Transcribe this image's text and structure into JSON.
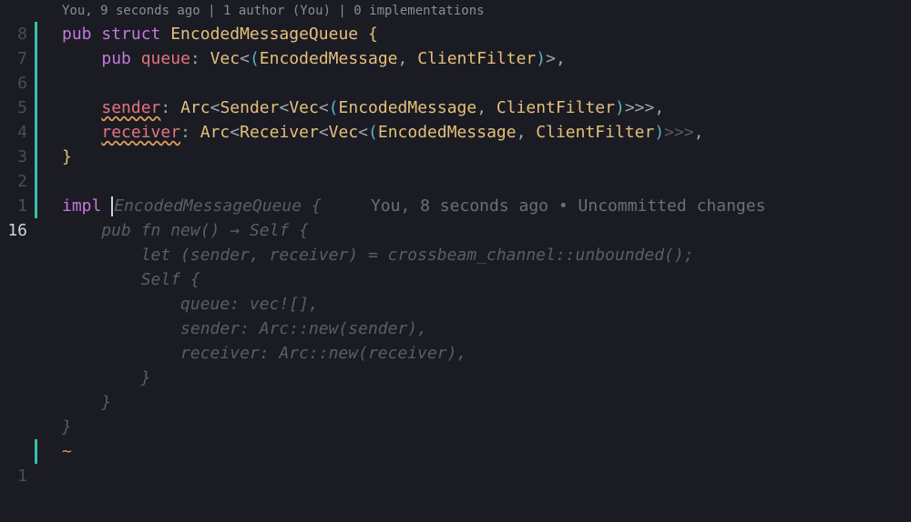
{
  "codelens": "You, 9 seconds ago | 1 author (You) | 0 implementations",
  "gutter": [
    "8",
    "7",
    "6",
    "5",
    "4",
    "3",
    "2",
    "1",
    "16",
    "",
    "",
    "",
    "",
    "",
    "",
    "",
    "",
    "",
    "1"
  ],
  "active_line_index": 8,
  "code": {
    "l1": {
      "pub": "pub ",
      "struct_kw": "struct ",
      "name": "EncodedMessageQueue",
      "brace": " {"
    },
    "l2": {
      "pad": "    ",
      "pub": "pub ",
      "field": "queue",
      "colon": ": ",
      "ty_vec": "Vec",
      "lt1": "<",
      "lp": "(",
      "t1": "EncodedMessage",
      "c1": ", ",
      "t2": "ClientFilter",
      "rp": ")",
      "gt1": ">",
      "c2": ","
    },
    "l4": {
      "pad": "    ",
      "field": "sender",
      "colon": ": ",
      "arc": "Arc",
      "lt1": "<",
      "sender": "Sender",
      "lt2": "<",
      "vec": "Vec",
      "lt3": "<",
      "lp": "(",
      "t1": "EncodedMessage",
      "c1": ", ",
      "t2": "ClientFilter",
      "rp": ")",
      "gt": ">>>",
      "c2": ","
    },
    "l5": {
      "pad": "    ",
      "field": "receiver",
      "colon": ": ",
      "arc": "Arc",
      "lt1": "<",
      "recv": "Receiver",
      "lt2": "<",
      "vec": "Vec",
      "lt3": "<",
      "lp": "(",
      "t1": "EncodedMessage",
      "c1": ", ",
      "t2": "ClientFilter",
      "rp": ")",
      "gt_dim": ">>>",
      "c2": ","
    },
    "l6": {
      "brace": "}"
    },
    "l8": {
      "impl": "impl ",
      "ghost_name": "EncodedMessageQueue {",
      "hint": "     You, 8 seconds ago • Uncommitted changes"
    },
    "g1": "    pub fn new() → Self {",
    "g2": "        let (sender, receiver) = crossbeam_channel::unbounded();",
    "g3": "        Self {",
    "g4": "            queue: vec![],",
    "g5": "            sender: Arc::new(sender),",
    "g6": "            receiver: Arc::new(receiver),",
    "g7": "        }",
    "g8": "    }",
    "g9": "}",
    "tilde": "~"
  }
}
